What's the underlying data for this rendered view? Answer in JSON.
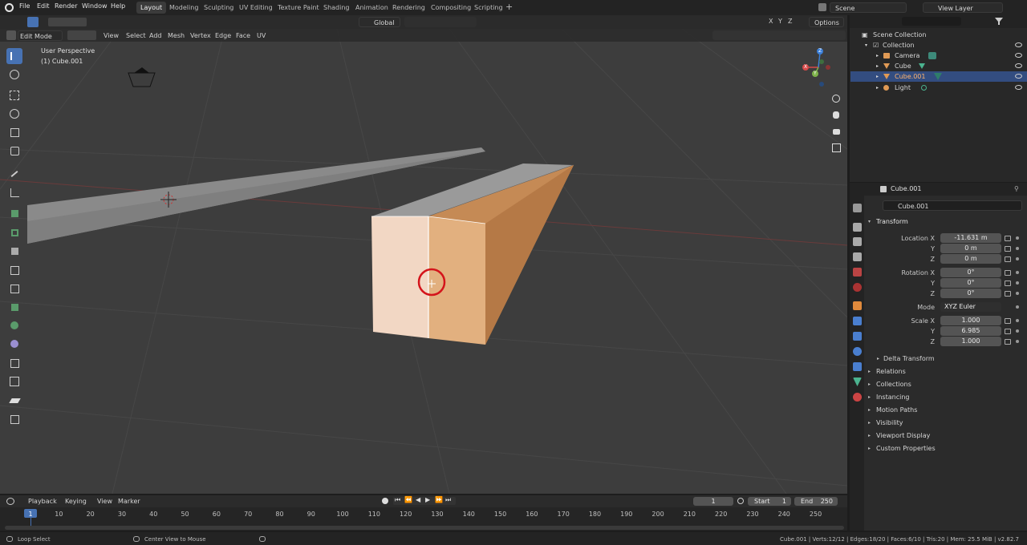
{
  "topbar": {
    "menus": [
      "File",
      "Edit",
      "Render",
      "Window",
      "Help"
    ],
    "workspaces": [
      "Layout",
      "Modeling",
      "Sculpting",
      "UV Editing",
      "Texture Paint",
      "Shading",
      "Animation",
      "Rendering",
      "Compositing",
      "Scripting"
    ],
    "active_workspace": "Layout",
    "scene": "Scene",
    "view_layer": "View Layer"
  },
  "viewport_header": {
    "mode": "Edit Mode",
    "menus": [
      "View",
      "Select",
      "Add",
      "Mesh",
      "Vertex",
      "Edge",
      "Face",
      "UV"
    ],
    "transform_orientation": "Global",
    "options": "Options",
    "axes": [
      "X",
      "Y",
      "Z"
    ]
  },
  "viewport": {
    "perspective": "User Perspective",
    "object": "(1) Cube.001"
  },
  "gizmo": {
    "x": "X",
    "y": "Y",
    "z": "Z"
  },
  "outliner": {
    "root": "Scene Collection",
    "collection": "Collection",
    "items": [
      "Camera",
      "Cube",
      "Cube.001",
      "Light"
    ],
    "selected": "Cube.001"
  },
  "properties": {
    "object_name": "Cube.001",
    "object_field": "Cube.001",
    "transform_title": "Transform",
    "location_label": "Location X",
    "rotation_label": "Rotation X",
    "scale_label": "Scale X",
    "mode_label": "Mode",
    "y": "Y",
    "z": "Z",
    "location": [
      "-11.631 m",
      "0 m",
      "0 m"
    ],
    "rotation": [
      "0°",
      "0°",
      "0°"
    ],
    "mode": "XYZ Euler",
    "scale": [
      "1.000",
      "6.985",
      "1.000"
    ],
    "delta": "Delta Transform",
    "sections": [
      "Relations",
      "Collections",
      "Instancing",
      "Motion Paths",
      "Visibility",
      "Viewport Display",
      "Custom Properties"
    ]
  },
  "timeline": {
    "menus": [
      "Playback",
      "Keying",
      "View",
      "Marker"
    ],
    "current_frame": "1",
    "start_label": "Start",
    "start": "1",
    "end_label": "End",
    "end": "250",
    "ticks": [
      "1",
      "10",
      "20",
      "30",
      "40",
      "50",
      "60",
      "70",
      "80",
      "90",
      "100",
      "110",
      "120",
      "130",
      "140",
      "150",
      "160",
      "170",
      "180",
      "190",
      "200",
      "210",
      "220",
      "230",
      "240",
      "250"
    ]
  },
  "statusbar": {
    "left": "Loop Select",
    "middle": "Center View to Mouse",
    "right": "Cube.001 | Verts:12/12 | Edges:18/20 | Faces:6/10 | Tris:20 | Mem: 25.5 MiB | v2.82.7"
  },
  "colors": {
    "accent": "#4772b3",
    "selected_face": "#e2b07f",
    "grid_bg": "#3d3d3d"
  }
}
